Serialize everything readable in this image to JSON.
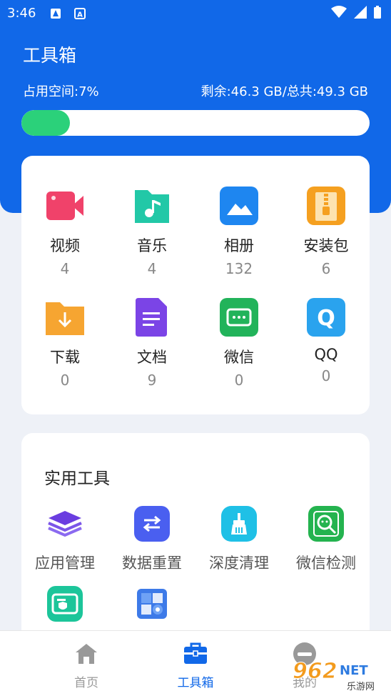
{
  "status_bar": {
    "time": "3:46",
    "icons": [
      "notification-app-icon",
      "notification-a-icon",
      "wifi-icon",
      "signal-icon",
      "battery-icon"
    ]
  },
  "header": {
    "title": "工具箱",
    "usage_label": "占用空间:7%",
    "remaining_label": "剩余:46.3 GB/总共:49.3 GB",
    "usage_fraction": 0.07,
    "accent_color": "#1168e8",
    "progress_color": "#2bd17a"
  },
  "categories": [
    {
      "label": "视频",
      "count": "4",
      "icon": "video-icon",
      "color": "#f0426a"
    },
    {
      "label": "音乐",
      "count": "4",
      "icon": "music-icon",
      "color": "#22c8a7"
    },
    {
      "label": "相册",
      "count": "132",
      "icon": "photo-album-icon",
      "color": "#1e86f0"
    },
    {
      "label": "安装包",
      "count": "6",
      "icon": "package-icon",
      "color": "#f5a020"
    },
    {
      "label": "下载",
      "count": "0",
      "icon": "download-folder-icon",
      "color": "#f6a531"
    },
    {
      "label": "文档",
      "count": "9",
      "icon": "document-icon",
      "color": "#7b44e6"
    },
    {
      "label": "微信",
      "count": "0",
      "icon": "wechat-icon",
      "color": "#22b35a"
    },
    {
      "label": "QQ",
      "count": "0",
      "icon": "qq-icon",
      "color": "#2aa3ee"
    }
  ],
  "tools": {
    "title": "实用工具",
    "items": [
      {
        "label": "应用管理",
        "icon": "layers-icon"
      },
      {
        "label": "数据重置",
        "icon": "swap-icon"
      },
      {
        "label": "深度清理",
        "icon": "broom-icon"
      },
      {
        "label": "微信检测",
        "icon": "wechat-scan-icon"
      },
      {
        "label": "",
        "icon": "card-shield-icon"
      },
      {
        "label": "",
        "icon": "cube-gear-icon"
      }
    ]
  },
  "bottom_nav": {
    "items": [
      {
        "label": "首页",
        "icon": "home-icon",
        "active": false
      },
      {
        "label": "工具箱",
        "icon": "toolbox-icon",
        "active": true
      },
      {
        "label": "我的",
        "icon": "profile-icon",
        "active": false
      }
    ]
  },
  "watermark": {
    "brand": "962",
    "net": "NET",
    "sub": "乐游网"
  }
}
